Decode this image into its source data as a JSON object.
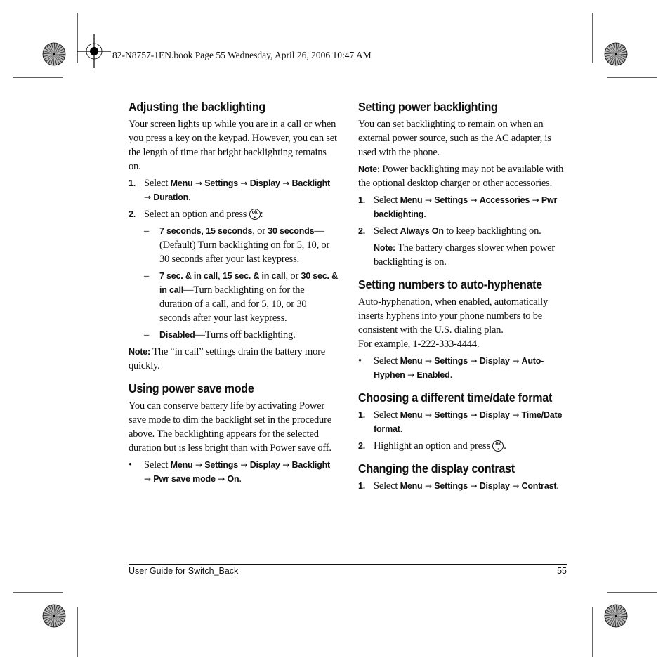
{
  "header": {
    "file_line": "82-N8757-1EN.book  Page 55  Wednesday, April 26, 2006  10:47 AM"
  },
  "icons": {
    "arrow": "→",
    "ok_key": "ok-key-icon"
  },
  "left": {
    "s1": {
      "title": "Adjusting the backlighting",
      "intro": "Your screen lights up while you are in a call or when you press a key on the keypad. However, you can set the length of time that bright backlighting remains on.",
      "step1_num": "1.",
      "step1_pre": "Select ",
      "menu": "Menu",
      "settings": "Settings",
      "display": "Display",
      "backlight": "Backlight",
      "duration": "Duration",
      "period": ".",
      "step2_num": "2.",
      "step2_text": "Select an option and press ",
      "colon": ":",
      "opt1_b1": "7 seconds",
      "opt1_t1": ", ",
      "opt1_b2": "15 seconds",
      "opt1_t2": ", or ",
      "opt1_b3": "30 seconds",
      "opt1_rest": "—(Default) Turn backlighting on for 5, 10, or 30 seconds after your last keypress.",
      "opt2_b1": "7 sec. & in call",
      "opt2_t1": ", ",
      "opt2_b2": "15 sec. & in call",
      "opt2_t2": ", or ",
      "opt2_b3": "30 sec. & in call",
      "opt2_rest": "—Turn backlighting on for the duration of a call, and for 5, 10, or 30 seconds after your last keypress.",
      "opt3_b1": "Disabled",
      "opt3_rest": "—Turns off backlighting.",
      "dash": "–",
      "note_label": "Note:",
      "note_text": "  The “in call” settings drain the battery more quickly."
    },
    "s2": {
      "title": "Using power save mode",
      "intro": "You can conserve battery life by activating Power save mode to dim the backlight set in the procedure above. The backlighting appears for the selected duration but is less bright than with Power save off.",
      "bullet": "•",
      "pre": "Select ",
      "menu": "Menu",
      "settings": "Settings",
      "display": "Display",
      "backlight": "Backlight",
      "pwr": "Pwr save mode",
      "on": "On",
      "period": "."
    }
  },
  "right": {
    "s1": {
      "title": "Setting power backlighting",
      "intro": "You can set backlighting to remain on when an external power source, such as the AC adapter, is used with the phone.",
      "note_label": "Note:",
      "note_text": "  Power backlighting may not be available with the optional desktop charger or other accessories.",
      "step1_num": "1.",
      "pre": "Select ",
      "menu": "Menu",
      "settings": "Settings",
      "accessories": "Accessories",
      "pwr": "Pwr backlighting",
      "period": ".",
      "step2_num": "2.",
      "step2_pre": "Select ",
      "always_on": "Always On",
      "step2_rest": " to keep backlighting on.",
      "note2_label": "Note:",
      "note2_text": "  The battery charges slower when power backlighting is on."
    },
    "s2": {
      "title": "Setting numbers to auto-hyphenate",
      "intro": "Auto-hyphenation, when enabled, automatically inserts hyphens into your phone numbers to be consistent with the U.S. dialing plan.",
      "example": "For example, 1-222-333-4444.",
      "bullet": "•",
      "pre": "Select ",
      "menu": "Menu",
      "settings": "Settings",
      "display": "Display",
      "autohyphen": "Auto-Hyphen",
      "enabled": "Enabled",
      "period": "."
    },
    "s3": {
      "title": "Choosing a different time/date format",
      "step1_num": "1.",
      "pre": "Select ",
      "menu": "Menu",
      "settings": "Settings",
      "display": "Display",
      "timedate": "Time/Date format",
      "period": ".",
      "step2_num": "2.",
      "step2_text": "Highlight an option and press ",
      "step2_end": "."
    },
    "s4": {
      "title": "Changing the display contrast",
      "step1_num": "1.",
      "pre": "Select ",
      "menu": "Menu",
      "settings": "Settings",
      "display": "Display",
      "contrast": "Contrast",
      "period": "."
    }
  },
  "footer": {
    "guide_title": "User Guide for Switch_Back",
    "page_number": "55"
  }
}
